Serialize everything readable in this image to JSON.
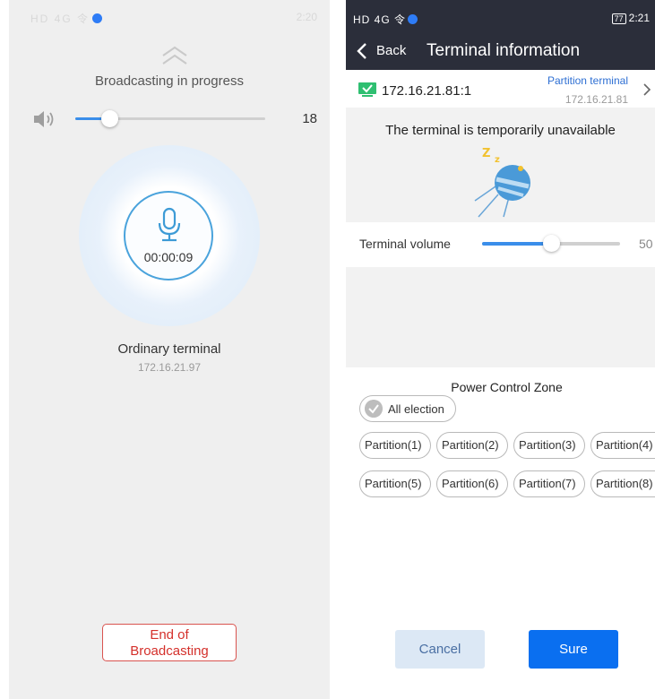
{
  "left_screen": {
    "status_bar": {
      "signal_text": "HD 4G 令",
      "time": "2:20"
    },
    "title": "Broadcasting in progress",
    "volume": {
      "value": "18",
      "level_fraction": 0.18
    },
    "timer": "00:00:09",
    "terminal_name": "Ordinary terminal",
    "terminal_ip": "172.16.21.97",
    "end_button_line1": "End of",
    "end_button_line2": "Broadcasting"
  },
  "right_screen": {
    "status_bar": {
      "signal_text": "HD 4G 令",
      "battery": "77",
      "time": "2:21"
    },
    "back_label": "Back",
    "title": "Terminal information",
    "terminal": {
      "ip": "172.16.21.81:1",
      "type": "Partition terminal",
      "ip_sub": "172.16.21.81"
    },
    "unavailable_text": "The terminal is temporarily unavailable",
    "terminal_volume": {
      "label": "Terminal volume",
      "value": "50",
      "level_fraction": 0.5
    },
    "power_control_zone": {
      "title": "Power Control Zone",
      "all_election": "All election",
      "partitions": [
        "Partition(1)",
        "Partition(2)",
        "Partition(3)",
        "Partition(4)",
        "Partition(5)",
        "Partition(6)",
        "Partition(7)",
        "Partition(8)"
      ]
    },
    "cancel_label": "Cancel",
    "sure_label": "Sure"
  },
  "colors": {
    "accent_blue": "#3a8eea",
    "end_red": "#d4302b",
    "sure_blue": "#0a6ff0",
    "header_dark": "#2b2e3a"
  }
}
